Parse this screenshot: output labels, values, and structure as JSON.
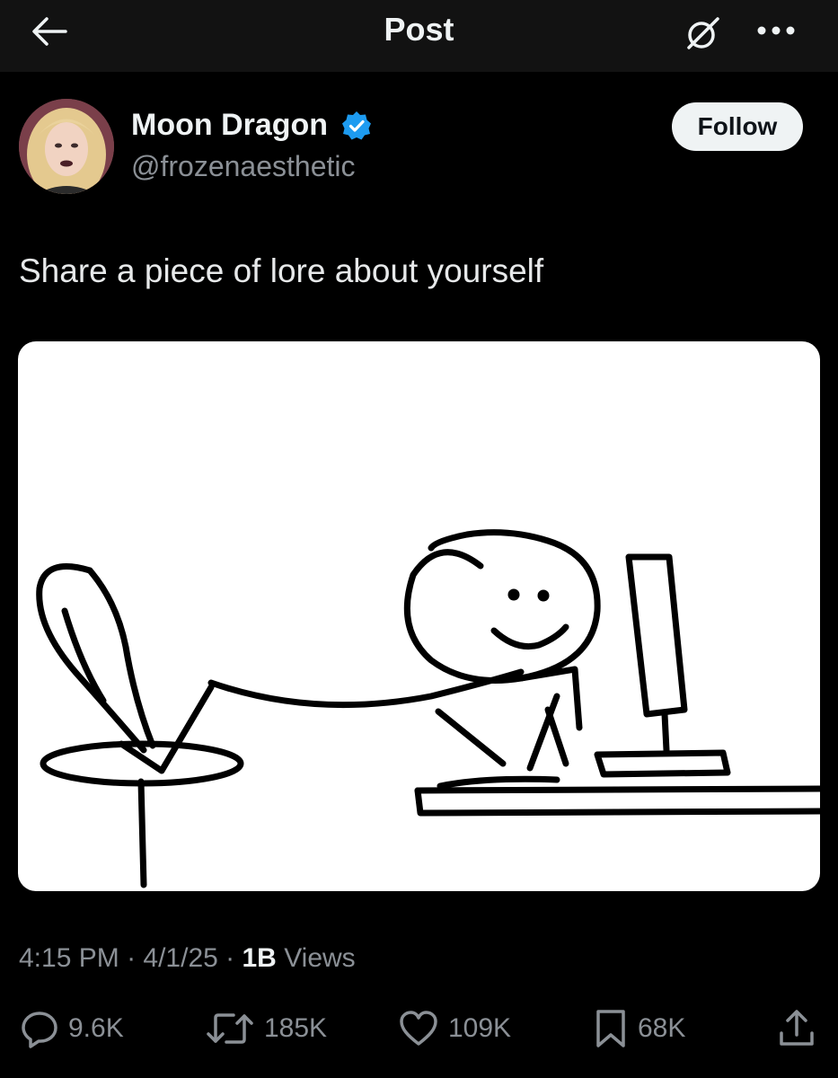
{
  "topbar": {
    "title": "Post",
    "back_icon": "arrow-left-icon",
    "grok_icon": "grok-icon",
    "more_icon": "ellipsis-icon"
  },
  "author": {
    "display_name": "Moon Dragon",
    "handle": "@frozenaesthetic",
    "verified": true,
    "follow_label": "Follow"
  },
  "post": {
    "text": "Share a piece of lore about yourself",
    "time": "4:15 PM",
    "date": "4/1/25",
    "views_count": "1B",
    "views_label": "Views"
  },
  "actions": {
    "replies": "9.6K",
    "reposts": "185K",
    "likes": "109K",
    "bookmarks": "68K"
  },
  "colors": {
    "background": "#000000",
    "topbar": "#121212",
    "text_primary": "#e7e9ea",
    "text_secondary": "#8b9096",
    "verified_blue": "#1d9bf0",
    "follow_bg": "#eff3f4"
  }
}
